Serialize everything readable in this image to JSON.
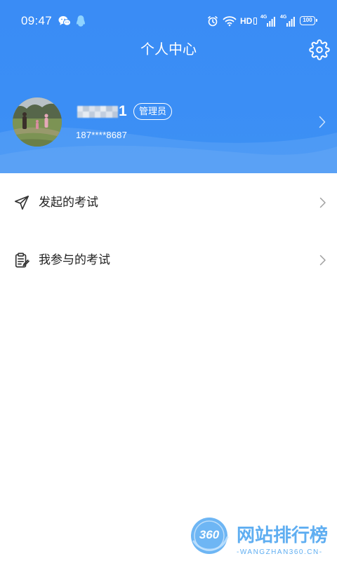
{
  "status_bar": {
    "time": "09:47",
    "hd_label": "HD",
    "sim1_network": "4G",
    "sim2_network": "4G",
    "battery_level": "100",
    "left_icons": [
      "wechat-icon",
      "qq-icon"
    ],
    "right_icons": [
      "alarm-icon",
      "wifi-icon",
      "hd-voice-icon",
      "signal-icon",
      "signal-icon",
      "battery-icon"
    ]
  },
  "header": {
    "title": "个人中心",
    "settings_icon": "gear-icon"
  },
  "profile": {
    "name_suffix": "1",
    "role_badge": "管理员",
    "phone": "187****8687",
    "chevron_icon": "chevron-right-icon"
  },
  "menu": {
    "items": [
      {
        "label": "发起的考试",
        "icon": "paper-plane-icon",
        "chevron_icon": "chevron-right-icon"
      },
      {
        "label": "我参与的考试",
        "icon": "clipboard-icon",
        "chevron_icon": "chevron-right-icon"
      }
    ]
  },
  "watermark": {
    "logo_text": "360",
    "title": "网站排行榜",
    "subtitle": "-WANGZHAN360.CN-"
  },
  "colors": {
    "header_blue": "#3B8EF5",
    "text_primary": "#222222",
    "chevron_grey": "#A0A0A0",
    "qq_icon": "#8FD3FF",
    "watermark_blue": "#4AA3F0"
  }
}
